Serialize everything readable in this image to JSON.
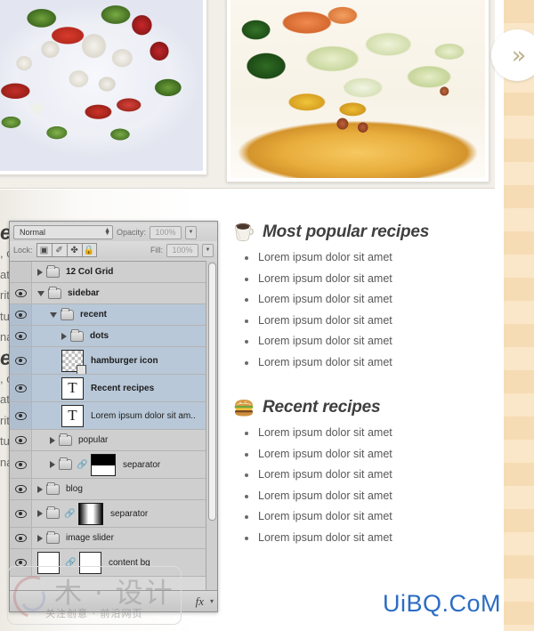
{
  "slider": {
    "photos": [
      {
        "name": "greek-salad-photo",
        "alt": "Greek salad with feta cheese, tomatoes and cucumber on white plate"
      },
      {
        "name": "tostada-photo",
        "alt": "Tostada with lettuce, cheese, beans and parsley"
      }
    ],
    "next_button": {
      "label": "»",
      "name": "slider-next-arrow"
    }
  },
  "photoshop_panel": {
    "options_bar": {
      "blend_mode": "Normal",
      "opacity_label": "Opacity:",
      "opacity_value": "100%",
      "lock_label": "Lock:",
      "fill_label": "Fill:",
      "fill_value": "100%",
      "lock_buttons": [
        {
          "name": "lock-transparent-pixels",
          "glyph": "⛶"
        },
        {
          "name": "lock-image-pixels",
          "glyph": "✐"
        },
        {
          "name": "lock-position",
          "glyph": "✤"
        },
        {
          "name": "lock-all",
          "glyph": "🔒"
        }
      ]
    },
    "layers": [
      {
        "name": "12 Col Grid",
        "type": "group",
        "indent": 1,
        "expanded": false,
        "visible": false,
        "selected": false,
        "bold": true
      },
      {
        "name": "sidebar",
        "type": "group",
        "indent": 1,
        "expanded": true,
        "visible": true,
        "selected": false,
        "bold": true
      },
      {
        "name": "recent",
        "type": "group",
        "indent": 2,
        "expanded": true,
        "visible": true,
        "selected": true,
        "bold": true
      },
      {
        "name": "dots",
        "type": "group",
        "indent": 3,
        "expanded": false,
        "visible": true,
        "selected": true,
        "bold": true
      },
      {
        "name": "hamburger icon",
        "type": "raster",
        "indent": 3,
        "expanded": null,
        "visible": true,
        "selected": true,
        "bold": true
      },
      {
        "name": "Recent recipes",
        "type": "text",
        "indent": 3,
        "expanded": null,
        "visible": true,
        "selected": true,
        "bold": true
      },
      {
        "name": "Lorem ipsum dolor sit am..",
        "type": "text",
        "indent": 3,
        "expanded": null,
        "visible": true,
        "selected": true,
        "bold": false
      },
      {
        "name": "popular",
        "type": "group",
        "indent": 2,
        "expanded": false,
        "visible": true,
        "selected": false,
        "bold": false
      },
      {
        "name": "separator",
        "type": "group-mask-half",
        "indent": 2,
        "expanded": false,
        "visible": true,
        "selected": false,
        "bold": false
      },
      {
        "name": "blog",
        "type": "group",
        "indent": 1,
        "expanded": false,
        "visible": true,
        "selected": false,
        "bold": false
      },
      {
        "name": "separator",
        "type": "group-mask-vgrad",
        "indent": 1,
        "expanded": false,
        "visible": true,
        "selected": false,
        "bold": false
      },
      {
        "name": "image slider",
        "type": "group",
        "indent": 1,
        "expanded": false,
        "visible": true,
        "selected": false,
        "bold": false
      },
      {
        "name": "content bg",
        "type": "raster-mask",
        "indent": 1,
        "expanded": null,
        "visible": true,
        "selected": false,
        "bold": false
      }
    ],
    "footer": {
      "fx_label": "fx",
      "caret": "▾"
    }
  },
  "content": {
    "sections": [
      {
        "icon": "coffee-cup-icon",
        "title": "Most popular recipes",
        "items": [
          "Lorem ipsum dolor sit amet",
          "Lorem ipsum dolor sit amet",
          "Lorem ipsum dolor sit amet",
          "Lorem ipsum dolor sit amet",
          "Lorem ipsum dolor sit amet",
          "Lorem ipsum dolor sit amet"
        ]
      },
      {
        "icon": "hamburger-icon",
        "title": "Recent recipes",
        "items": [
          "Lorem ipsum dolor sit amet",
          "Lorem ipsum dolor sit amet",
          "Lorem ipsum dolor sit amet",
          "Lorem ipsum dolor sit amet",
          "Lorem ipsum dolor sit amet",
          "Lorem ipsum dolor sit amet"
        ]
      }
    ]
  },
  "background_text": {
    "big_letter_1": "e",
    "lines_1": [
      ", c",
      "at",
      "rit",
      "tu",
      "na"
    ],
    "big_letter_2": "e",
    "lines_2": [
      ", c",
      "at",
      "rit",
      "tu",
      "na"
    ]
  },
  "watermarks": {
    "chinese_big": "木 · 设计",
    "chinese_small": "关注创意 · 前沿网页",
    "site": "UiBQ.CoM"
  },
  "colors": {
    "stripe_light": "#fae6c8",
    "stripe_dark": "#f6dcb4",
    "panel_bg": "#d4d4d4",
    "layer_selected": "#b8c8d8",
    "site_blue": "#2b6cc4",
    "arrow_tan": "#bbb08c"
  }
}
